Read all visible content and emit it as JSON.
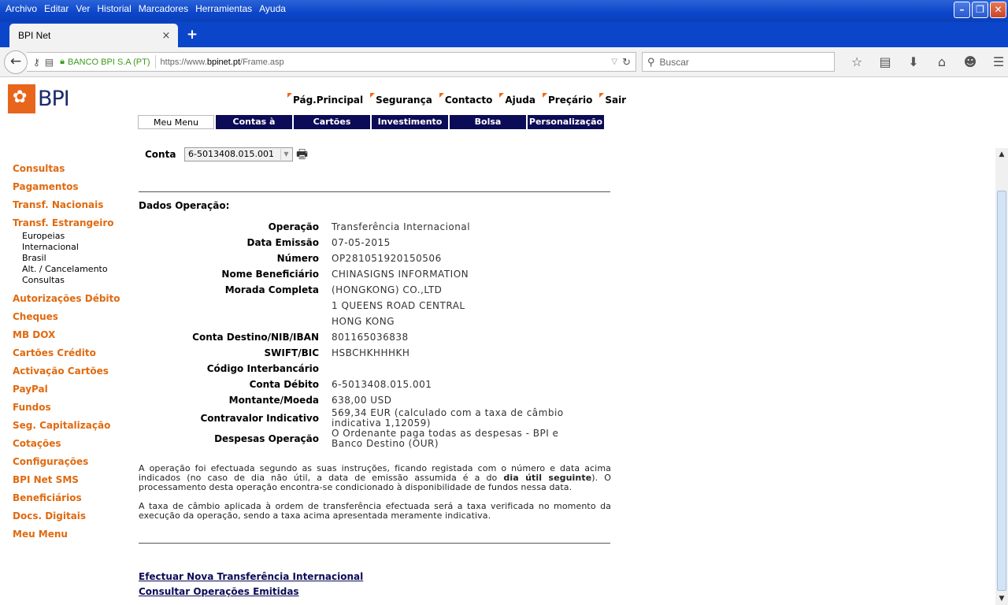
{
  "menubar": [
    "Archivo",
    "Editar",
    "Ver",
    "Historial",
    "Marcadores",
    "Herramientas",
    "Ayuda"
  ],
  "window_buttons": {
    "minimize": "–",
    "maximize": "❐",
    "close": "✕"
  },
  "tab": {
    "title": "BPI Net",
    "close": "×",
    "new_tab": "+"
  },
  "urlbar": {
    "site_identity": "BANCO BPI S.A (PT)",
    "url_prefix": "https://www.",
    "url_domain": "bpinet.pt",
    "url_path": "/Frame.asp"
  },
  "search": {
    "placeholder": "Buscar"
  },
  "toolbar_icons": [
    "star-icon",
    "reading-list-icon",
    "download-icon",
    "home-icon",
    "hello-icon",
    "menu-icon"
  ],
  "logo": {
    "text": "BPI"
  },
  "top_links": [
    "Pág.Principal",
    "Segurança",
    "Contacto",
    "Ajuda",
    "Preçário",
    "Sair"
  ],
  "nav_tabs": [
    "Meu Menu",
    "Contas à Ordem",
    "Cartões",
    "Investimento",
    "Bolsa",
    "Personalização"
  ],
  "sidebar": {
    "items_before": [
      "Consultas",
      "Pagamentos",
      "Transf. Nacionais",
      "Transf. Estrangeiro"
    ],
    "subitems": [
      "Europeias",
      "Internacional",
      "Brasil",
      "Alt. / Cancelamento",
      "Consultas"
    ],
    "items_after": [
      "Autorizações Débito",
      "Cheques",
      "MB DOX",
      "Cartões Crédito",
      "Activação Cartões",
      "PayPal",
      "Fundos",
      "Seg. Capitalização",
      "Cotações",
      "Configurações",
      "BPI Net SMS",
      "Beneficiários",
      "Docs. Digitais",
      "Meu Menu"
    ]
  },
  "conta": {
    "label": "Conta",
    "value": "6-5013408.015.001"
  },
  "section_title": "Dados Operação:",
  "details": [
    {
      "label": "Operação",
      "value": "Transferência Internacional"
    },
    {
      "label": "Data Emissão",
      "value": "07-05-2015"
    },
    {
      "label": "Número",
      "value": "OP281051920150506"
    },
    {
      "label": "Nome Beneficiário",
      "value": "CHINASIGNS INFORMATION"
    },
    {
      "label": "Morada Completa",
      "value": "(HONGKONG) CO.,LTD"
    },
    {
      "label": "",
      "value": "1 QUEENS ROAD CENTRAL"
    },
    {
      "label": "",
      "value": "HONG KONG"
    },
    {
      "label": "Conta Destino/NIB/IBAN",
      "value": "801165036838"
    },
    {
      "label": "SWIFT/BIC",
      "value": "HSBCHKHHHKH"
    },
    {
      "label": "Código Interbancário",
      "value": ""
    },
    {
      "label": "Conta Débito",
      "value": "6-5013408.015.001"
    },
    {
      "label": "Montante/Moeda",
      "value": "638,00 USD"
    },
    {
      "label": "Contravalor Indicativo",
      "value": "569,34 EUR (calculado com a taxa de câmbio indicativa  1,12059)"
    },
    {
      "label": "Despesas Operação",
      "value": "O Ordenante paga todas as despesas - BPI e Banco Destino (OUR)"
    }
  ],
  "note1": {
    "before": "A operação foi efectuada segundo as suas instruções, ficando registada com o número e data acima indicados (no caso de dia não útil, a data de emissão assumida é a do ",
    "bold": "dia útil seguinte",
    "after": "). O processamento desta operação encontra-se condicionado à disponibilidade de fundos nessa data."
  },
  "note2": "A taxa de câmbio aplicada à ordem de transferência efectuada será a taxa verificada no momento da execução da operação, sendo a taxa acima apresentada meramente indicativa.",
  "actions": [
    "Efectuar Nova Transferência Internacional",
    "Consultar Operações Emitidas"
  ]
}
